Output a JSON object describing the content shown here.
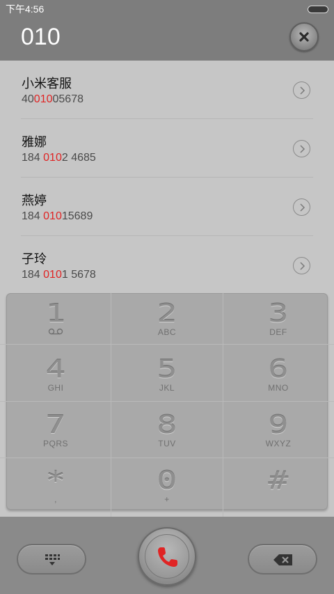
{
  "status_bar": {
    "time": "下午4:56"
  },
  "header": {
    "typed_number": "010"
  },
  "contacts": [
    {
      "name": "小米客服",
      "phone_prefix": "40",
      "phone_match": "010",
      "phone_suffix": "05678"
    },
    {
      "name": "雅娜",
      "phone_prefix": "184 ",
      "phone_match": "010",
      "phone_suffix": "2 4685"
    },
    {
      "name": "燕婷",
      "phone_prefix": "184 ",
      "phone_match": "010",
      "phone_suffix": "15689"
    },
    {
      "name": "子玲",
      "phone_prefix": "184 ",
      "phone_match": "010",
      "phone_suffix": "1 5678"
    }
  ],
  "keypad": [
    {
      "digit": "1",
      "letters": ""
    },
    {
      "digit": "2",
      "letters": "ABC"
    },
    {
      "digit": "3",
      "letters": "DEF"
    },
    {
      "digit": "4",
      "letters": "GHI"
    },
    {
      "digit": "5",
      "letters": "JKL"
    },
    {
      "digit": "6",
      "letters": "MNO"
    },
    {
      "digit": "7",
      "letters": "PQRS"
    },
    {
      "digit": "8",
      "letters": "TUV"
    },
    {
      "digit": "9",
      "letters": "WXYZ"
    },
    {
      "digit": "*",
      "letters": ","
    },
    {
      "digit": "0",
      "letters": "+"
    },
    {
      "digit": "#",
      "letters": ""
    }
  ],
  "colors": {
    "highlight": "#e02424",
    "call_icon": "#e02424",
    "header_bg": "#7d7d7d"
  },
  "icons": {
    "clear": "close-icon",
    "row_arrow": "chevron-right-icon",
    "voicemail": "voicemail-icon",
    "dialpad_toggle": "dialpad-icon",
    "call": "phone-icon",
    "backspace": "backspace-icon"
  }
}
